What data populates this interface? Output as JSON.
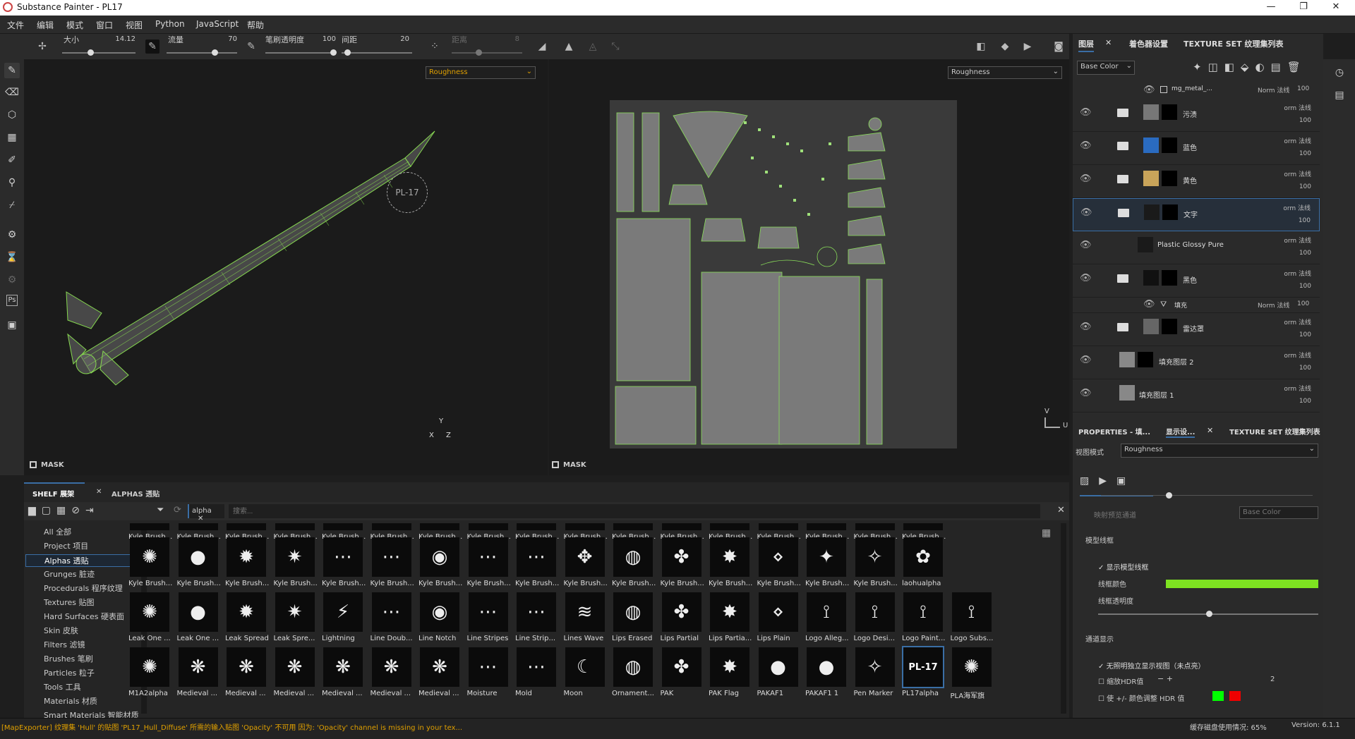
{
  "window": {
    "title": "Substance Painter - PL17",
    "min": "—",
    "max": "❐",
    "close": "✕"
  },
  "menu": [
    "文件",
    "编辑",
    "模式",
    "窗口",
    "视图",
    "Python",
    "JavaScript",
    "帮助"
  ],
  "toolbar": {
    "size_label": "大小",
    "size_value": "14.12",
    "flow_label": "流量",
    "flow_value": "70",
    "opacity_label": "笔刷透明度",
    "opacity_value": "100",
    "spacing_label": "间距",
    "spacing_value": "20",
    "angle_label": "距离",
    "angle_value": "8"
  },
  "viewport3d": {
    "channel": "Roughness",
    "mask_label": "MASK",
    "decal_text": "PL-17",
    "axis_y": "Y",
    "axis_x": "X",
    "axis_z": "Z"
  },
  "viewport2d": {
    "channel": "Roughness",
    "mask_label": "MASK",
    "axis_v": "V",
    "axis_u": "U"
  },
  "layers_panel": {
    "tab_layers": "图层",
    "tab_colorset": "着色器设置",
    "tab_texset": "TEXTURE SET 纹理集列表",
    "channel": "Base Color",
    "top_mask": {
      "name": "mg_metal_...",
      "blend": "Norm 法线",
      "opacity": "100"
    },
    "rows": [
      {
        "name": "污渍",
        "blend": "orm 法线",
        "opacity": "100",
        "color": "#777"
      },
      {
        "name": "蓝色",
        "blend": "orm 法线",
        "opacity": "100",
        "color": "#2a6bc0"
      },
      {
        "name": "黄色",
        "blend": "orm 法线",
        "opacity": "100",
        "color": "#c9a45a"
      },
      {
        "name": "文字",
        "blend": "orm 法线",
        "opacity": "100",
        "color": "#1a1a1a"
      },
      {
        "name": "Plastic Glossy Pure",
        "blend": "orm 法线",
        "opacity": "100",
        "color": "#1a1a1a"
      },
      {
        "name": "黑色",
        "blend": "orm 法线",
        "opacity": "100",
        "color": "#111111"
      },
      {
        "name": "填充",
        "blend": "Norm 法线",
        "opacity": "100",
        "color": ""
      },
      {
        "name": "雷达罩",
        "blend": "orm 法线",
        "opacity": "100",
        "color": "#666"
      },
      {
        "name": "填充图层 2",
        "blend": "orm 法线",
        "opacity": "100",
        "color": "#888"
      },
      {
        "name": "填充图层 1",
        "blend": "orm 法线",
        "opacity": "100",
        "color": "#888"
      }
    ]
  },
  "props_panel": {
    "tab_props": "PROPERTIES - 填...",
    "tab_display": "显示设...",
    "tab_texset": "TEXTURE SET 纹理集列表",
    "view_mode_label": "视图模式",
    "view_mode_value": "Roughness",
    "map_channel_label": "映射预览通道",
    "map_channel_value": "Base Color",
    "wireframe_section": "模型线框",
    "show_wireframe": "显示模型线框",
    "wire_color_label": "线框颜色",
    "wire_color": "#7ee321",
    "wire_opacity_label": "线框透明度",
    "channel_section": "通道显示",
    "hdr_isolate": "无照明独立显示视图（未点亮）",
    "hdr_scale_label": "缩放HDR值",
    "hdr_scale_value": "2",
    "hdr_adjust_label": "使 +/- 颜色调整 HDR 值"
  },
  "shelf": {
    "tab_shelf": "SHELF 展架",
    "tab_alphas": "ALPHAS 透贴",
    "filter_chip": "alpha",
    "search_placeholder": "搜索...",
    "categories": [
      "All 全部",
      "Project 项目",
      "Alphas 透贴",
      "Grunges 脏迹",
      "Procedurals 程序纹理",
      "Textures 贴图",
      "Hard Surfaces 硬表面",
      "Skin 皮肤",
      "Filters 滤镜",
      "Brushes 笔刷",
      "Particles 粒子",
      "Tools 工具",
      "Materials 材质",
      "Smart Materials 智能材质"
    ],
    "row1": [
      "Kyle Brush...",
      "Kyle Brush...",
      "Kyle Brush...",
      "Kyle Brush...",
      "Kyle Brush...",
      "Kyle Brush...",
      "Kyle Brush...",
      "Kyle Brush...",
      "Kyle Brush...",
      "Kyle Brush...",
      "Kyle Brush...",
      "Kyle Brush...",
      "Kyle Brush...",
      "Kyle Brush...",
      "Kyle Brush...",
      "Kyle Brush...",
      "Kyle Brush..."
    ],
    "row2": [
      "Kyle Brush...",
      "Kyle Brush...",
      "Kyle Brush...",
      "Kyle Brush...",
      "Kyle Brush...",
      "Kyle Brush...",
      "Kyle Brush...",
      "Kyle Brush...",
      "Kyle Brush...",
      "Kyle Brush...",
      "Kyle Brush...",
      "Kyle Brush...",
      "Kyle Brush...",
      "Kyle Brush...",
      "Kyle Brush...",
      "Kyle Brush...",
      "laohualpha"
    ],
    "row3": [
      "Leak One ...",
      "Leak One ...",
      "Leak Spread",
      "Leak Spre...",
      "Lightning",
      "Line Doub...",
      "Line Notch",
      "Line Stripes",
      "Line Strip...",
      "Lines Wave",
      "Lips Erased",
      "Lips Partial",
      "Lips Partia...",
      "Lips Plain",
      "Logo Alleg...",
      "Logo Desi...",
      "Logo Paint...",
      "Logo Subs..."
    ],
    "row4": [
      "M1A2alpha",
      "Medieval ...",
      "Medieval ...",
      "Medieval ...",
      "Medieval ...",
      "Medieval ...",
      "Medieval ...",
      "Moisture",
      "Mold",
      "Moon",
      "Ornament...",
      "PAK",
      "PAK Flag",
      "PAKAF1",
      "PAKAF1 1",
      "Pen Marker",
      "PL17alpha",
      "PLA海军旗"
    ],
    "pl17_text": "PL-17"
  },
  "status": {
    "message": "[MapExporter] 纹理集 'Hull' 的贴图 'PL17_Hull_Diffuse' 所需的输入贴图 'Opacity' 不可用 因为: 'Opacity' channel is missing in your tex...",
    "cache": "缓存磁盘使用情况:  65%",
    "version": "Version: 6.1.1"
  }
}
